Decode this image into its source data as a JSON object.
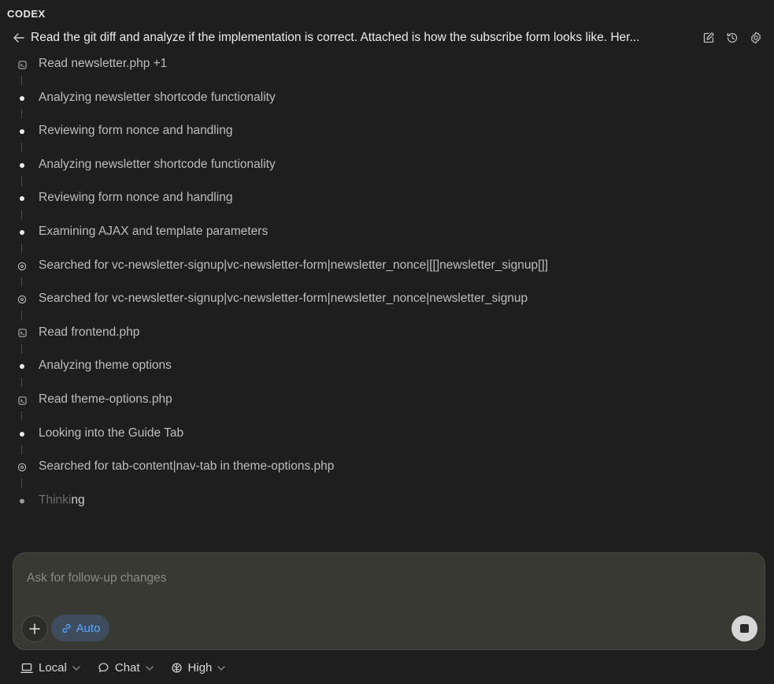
{
  "app": {
    "name": "CODEX"
  },
  "header": {
    "title": "Read the git diff and analyze if the implementation is correct. Attached is how the subscribe form looks like. Her..."
  },
  "timeline": {
    "steps": [
      {
        "kind": "file",
        "label": "Read newsletter.php +1"
      },
      {
        "kind": "dot",
        "label": "Analyzing newsletter shortcode functionality"
      },
      {
        "kind": "dot",
        "label": "Reviewing form nonce and handling"
      },
      {
        "kind": "dot",
        "label": "Analyzing newsletter shortcode functionality"
      },
      {
        "kind": "dot",
        "label": "Reviewing form nonce and handling"
      },
      {
        "kind": "dot",
        "label": "Examining AJAX and template parameters"
      },
      {
        "kind": "search",
        "label": "Searched for vc-newsletter-signup|vc-newsletter-form|newsletter_nonce|[[]newsletter_signup[]]"
      },
      {
        "kind": "search",
        "label": "Searched for vc-newsletter-signup|vc-newsletter-form|newsletter_nonce|newsletter_signup"
      },
      {
        "kind": "file",
        "label": "Read frontend.php"
      },
      {
        "kind": "dot",
        "label": "Analyzing theme options"
      },
      {
        "kind": "file",
        "label": "Read theme-options.php"
      },
      {
        "kind": "dot",
        "label": "Looking into the Guide Tab"
      },
      {
        "kind": "search",
        "label": "Searched for tab-content|nav-tab in theme-options.php"
      }
    ],
    "thinking": {
      "dim": "Thinki",
      "bright": "ng"
    }
  },
  "composer": {
    "placeholder": "Ask for follow-up changes",
    "mode_label": "Auto"
  },
  "footer": {
    "location_label": "Local",
    "mode_label": "Chat",
    "effort_label": "High"
  },
  "colors": {
    "background": "#1e1e1e",
    "composer": "#393933",
    "accent_blue": "#5aa6ff",
    "text_secondary": "#bdbdbd"
  }
}
